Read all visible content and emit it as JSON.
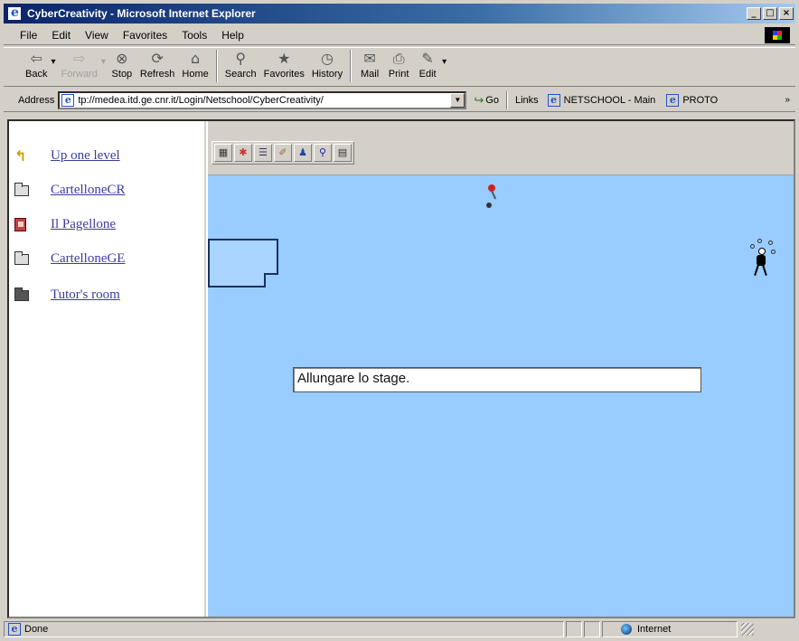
{
  "window": {
    "title": "CyberCreativity - Microsoft Internet Explorer",
    "buttons": [
      "_",
      "□",
      "×"
    ]
  },
  "menu": {
    "items": [
      "File",
      "Edit",
      "View",
      "Favorites",
      "Tools",
      "Help"
    ]
  },
  "toolbar": {
    "buttons": [
      {
        "label": "Back",
        "icon": "back-arrow-icon",
        "glyph": "⇦"
      },
      {
        "label": "Forward",
        "icon": "forward-arrow-icon",
        "glyph": "⇨"
      },
      {
        "label": "Stop",
        "icon": "stop-icon",
        "glyph": "⊗"
      },
      {
        "label": "Refresh",
        "icon": "refresh-icon",
        "glyph": "⟳"
      },
      {
        "label": "Home",
        "icon": "home-icon",
        "glyph": "⌂"
      },
      {
        "label": "Search",
        "icon": "search-icon",
        "glyph": "⚲"
      },
      {
        "label": "Favorites",
        "icon": "favorites-icon",
        "glyph": "★"
      },
      {
        "label": "History",
        "icon": "history-icon",
        "glyph": "◷"
      },
      {
        "label": "Mail",
        "icon": "mail-icon",
        "glyph": "✉"
      },
      {
        "label": "Print",
        "icon": "print-icon",
        "glyph": "⎙"
      },
      {
        "label": "Edit",
        "icon": "edit-icon",
        "glyph": "✎"
      }
    ]
  },
  "address": {
    "label": "Address",
    "url": "tp://medea.itd.ge.cnr.it/Login/Netschool/CyberCreativity/",
    "go_label": "Go",
    "links_label": "Links",
    "links": [
      "NETSCHOOL - Main",
      "PROTO"
    ]
  },
  "nav": {
    "items": [
      {
        "label": "Up one level",
        "icon": "up-arrow-icon"
      },
      {
        "label": "CartelloneCR",
        "icon": "folder-icon"
      },
      {
        "label": "Il Pagellone",
        "icon": "book-icon"
      },
      {
        "label": "CartelloneGE",
        "icon": "folder-icon"
      },
      {
        "label": "Tutor's room",
        "icon": "folder-dark-icon"
      }
    ]
  },
  "workspace": {
    "tools": [
      {
        "icon": "table-icon",
        "glyph": "▦"
      },
      {
        "icon": "paint-icon",
        "glyph": "✱"
      },
      {
        "icon": "list-icon",
        "glyph": "☰"
      },
      {
        "icon": "note-edit-icon",
        "glyph": "✐"
      },
      {
        "icon": "people-icon",
        "glyph": "♟"
      },
      {
        "icon": "magnifier-icon",
        "glyph": "⚲"
      },
      {
        "icon": "document-icon",
        "glyph": "▤"
      }
    ],
    "text_field_value": "Allungare lo stage."
  },
  "status": {
    "text": "Done",
    "zone": "Internet"
  },
  "colors": {
    "workspace_bg": "#99ccff",
    "link": "#3c3ca0",
    "titlebar": "#0a246a"
  }
}
